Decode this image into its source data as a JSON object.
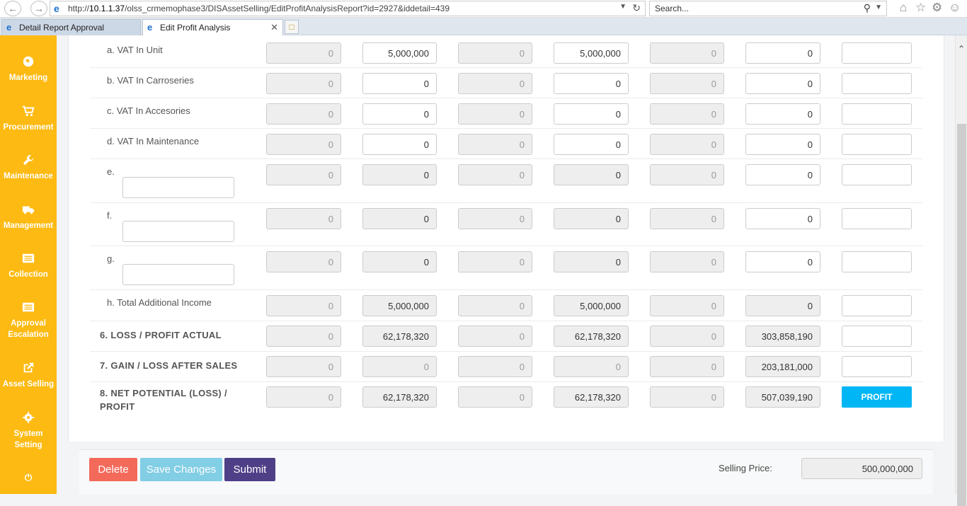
{
  "browser": {
    "url_prefix": "http://",
    "url_host": "10.1.1.37",
    "url_path": "/olss_crmemophase3/DISAssetSelling/EditProfitAnalysisReport?id=2927&iddetail=439",
    "search_placeholder": "Search...",
    "tabs": [
      {
        "label": "Detail Report Approval"
      },
      {
        "label": "Edit Profit Analysis"
      }
    ]
  },
  "sidebar": {
    "items": [
      {
        "label": "Marketing",
        "icon": "globe-icon"
      },
      {
        "label": "Procurement",
        "icon": "cart-icon"
      },
      {
        "label": "Maintenance",
        "icon": "wrench-icon"
      },
      {
        "label": "Management",
        "icon": "truck-icon"
      },
      {
        "label": "Collection",
        "icon": "list-icon"
      },
      {
        "label": "Approval Escalation",
        "icon": "list-icon"
      },
      {
        "label": "Asset Selling",
        "icon": "external-link-icon"
      },
      {
        "label": "System Setting",
        "icon": "gear-icon"
      }
    ],
    "power_icon": "power-icon"
  },
  "rows": [
    {
      "label": "a. VAT In Unit",
      "values": [
        "0",
        "5,000,000",
        "0",
        "5,000,000",
        "0",
        "0",
        ""
      ]
    },
    {
      "label": "b. VAT In Carroseries",
      "values": [
        "0",
        "0",
        "0",
        "0",
        "0",
        "0",
        ""
      ]
    },
    {
      "label": "c. VAT In Accesories",
      "values": [
        "0",
        "0",
        "0",
        "0",
        "0",
        "0",
        ""
      ]
    },
    {
      "label": "d. VAT In Maintenance",
      "values": [
        "0",
        "0",
        "0",
        "0",
        "0",
        "0",
        ""
      ]
    },
    {
      "label": "e.",
      "values": [
        "0",
        "0",
        "0",
        "0",
        "0",
        "0",
        ""
      ]
    },
    {
      "label": "f.",
      "values": [
        "0",
        "0",
        "0",
        "0",
        "0",
        "0",
        ""
      ]
    },
    {
      "label": "g.",
      "values": [
        "0",
        "0",
        "0",
        "0",
        "0",
        "0",
        ""
      ]
    },
    {
      "label": "h. Total Additional Income",
      "values": [
        "0",
        "5,000,000",
        "0",
        "5,000,000",
        "0",
        "0",
        ""
      ]
    },
    {
      "label": "6. LOSS / PROFIT ACTUAL",
      "values": [
        "0",
        "62,178,320",
        "0",
        "62,178,320",
        "0",
        "303,858,190",
        ""
      ]
    },
    {
      "label": "7. GAIN / LOSS AFTER SALES",
      "values": [
        "0",
        "0",
        "0",
        "0",
        "0",
        "203,181,000",
        ""
      ]
    },
    {
      "label_line1": "8. NET POTENTIAL (LOSS) /",
      "label_line2": "PROFIT",
      "values": [
        "0",
        "62,178,320",
        "0",
        "62,178,320",
        "0",
        "507,039,190"
      ],
      "status": "PROFIT"
    }
  ],
  "footer": {
    "delete_label": "Delete",
    "save_label": "Save Changes",
    "submit_label": "Submit",
    "selling_price_label": "Selling Price:",
    "selling_price_value": "500,000,000"
  },
  "colors": {
    "sidebar": "#fdba12",
    "profit_badge": "#00b6f5",
    "delete_button": "#f36a5a",
    "save_button": "#5bc0de",
    "submit_button": "#4f3f87"
  }
}
